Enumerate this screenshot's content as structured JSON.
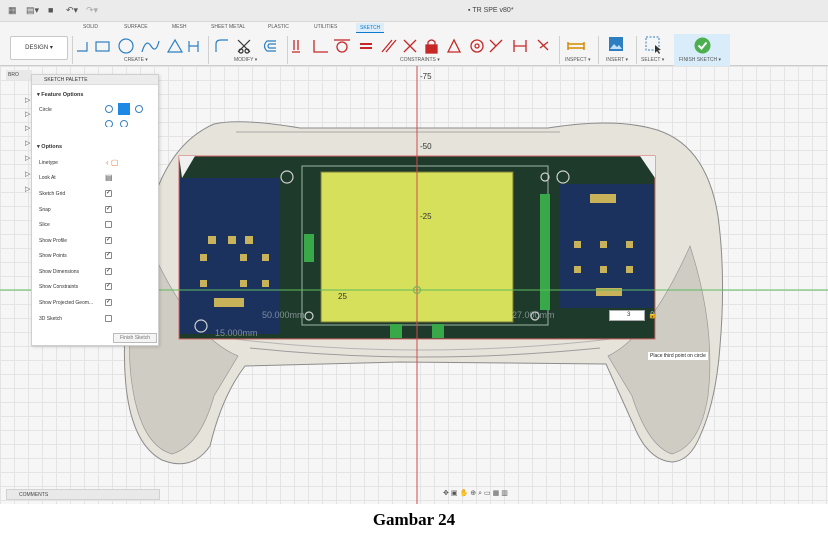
{
  "titlebar": {
    "doc_title": "TR SPE v80*",
    "grid_icon": "apps-grid-icon",
    "file_icon": "file-icon",
    "undo_icon": "undo-icon",
    "redo_icon": "redo-icon"
  },
  "tabs": [
    "SOLID",
    "SURFACE",
    "MESH",
    "SHEET METAL",
    "PLASTIC",
    "UTILITIES",
    "SKETCH"
  ],
  "active_tab": "SKETCH",
  "ribbon": {
    "design": "DESIGN ▾",
    "groups": {
      "create": "CREATE ▾",
      "modify": "MODIFY ▾",
      "constraints": "CONSTRAINTS ▾",
      "inspect": "INSPECT ▾",
      "insert": "INSERT ▾",
      "select": "SELECT ▾",
      "finish": "FINISH SKETCH ▾"
    }
  },
  "browser": {
    "label": "BRO"
  },
  "palette": {
    "title": "SKETCH PALETTE",
    "feature_options": "Feature Options",
    "circle_label": "Circle",
    "options": "Options",
    "rows": [
      {
        "label": "Linetype",
        "type": "icon"
      },
      {
        "label": "Look At",
        "type": "icon"
      },
      {
        "label": "Sketch Grid",
        "checked": true
      },
      {
        "label": "Snap",
        "checked": true
      },
      {
        "label": "Slice",
        "checked": false
      },
      {
        "label": "Show Profile",
        "checked": true
      },
      {
        "label": "Show Points",
        "checked": true
      },
      {
        "label": "Show Dimensions",
        "checked": true
      },
      {
        "label": "Show Constraints",
        "checked": true
      },
      {
        "label": "Show Projected Geom...",
        "checked": true
      },
      {
        "label": "3D Sketch",
        "checked": false
      }
    ],
    "finish_button": "Finish Sketch"
  },
  "canvas": {
    "axis_labels": {
      "v75": "-75",
      "v50": "-50",
      "v25": "-25",
      "h25": "25"
    },
    "dimension_input": "3",
    "tooltip": "Place third point on circle",
    "pcb_dims": {
      "d1": "15.000mm",
      "d2": "50.000mm",
      "d3": "27.000mm"
    }
  },
  "comments": "COMMENTS",
  "caption": "Gambar 24"
}
